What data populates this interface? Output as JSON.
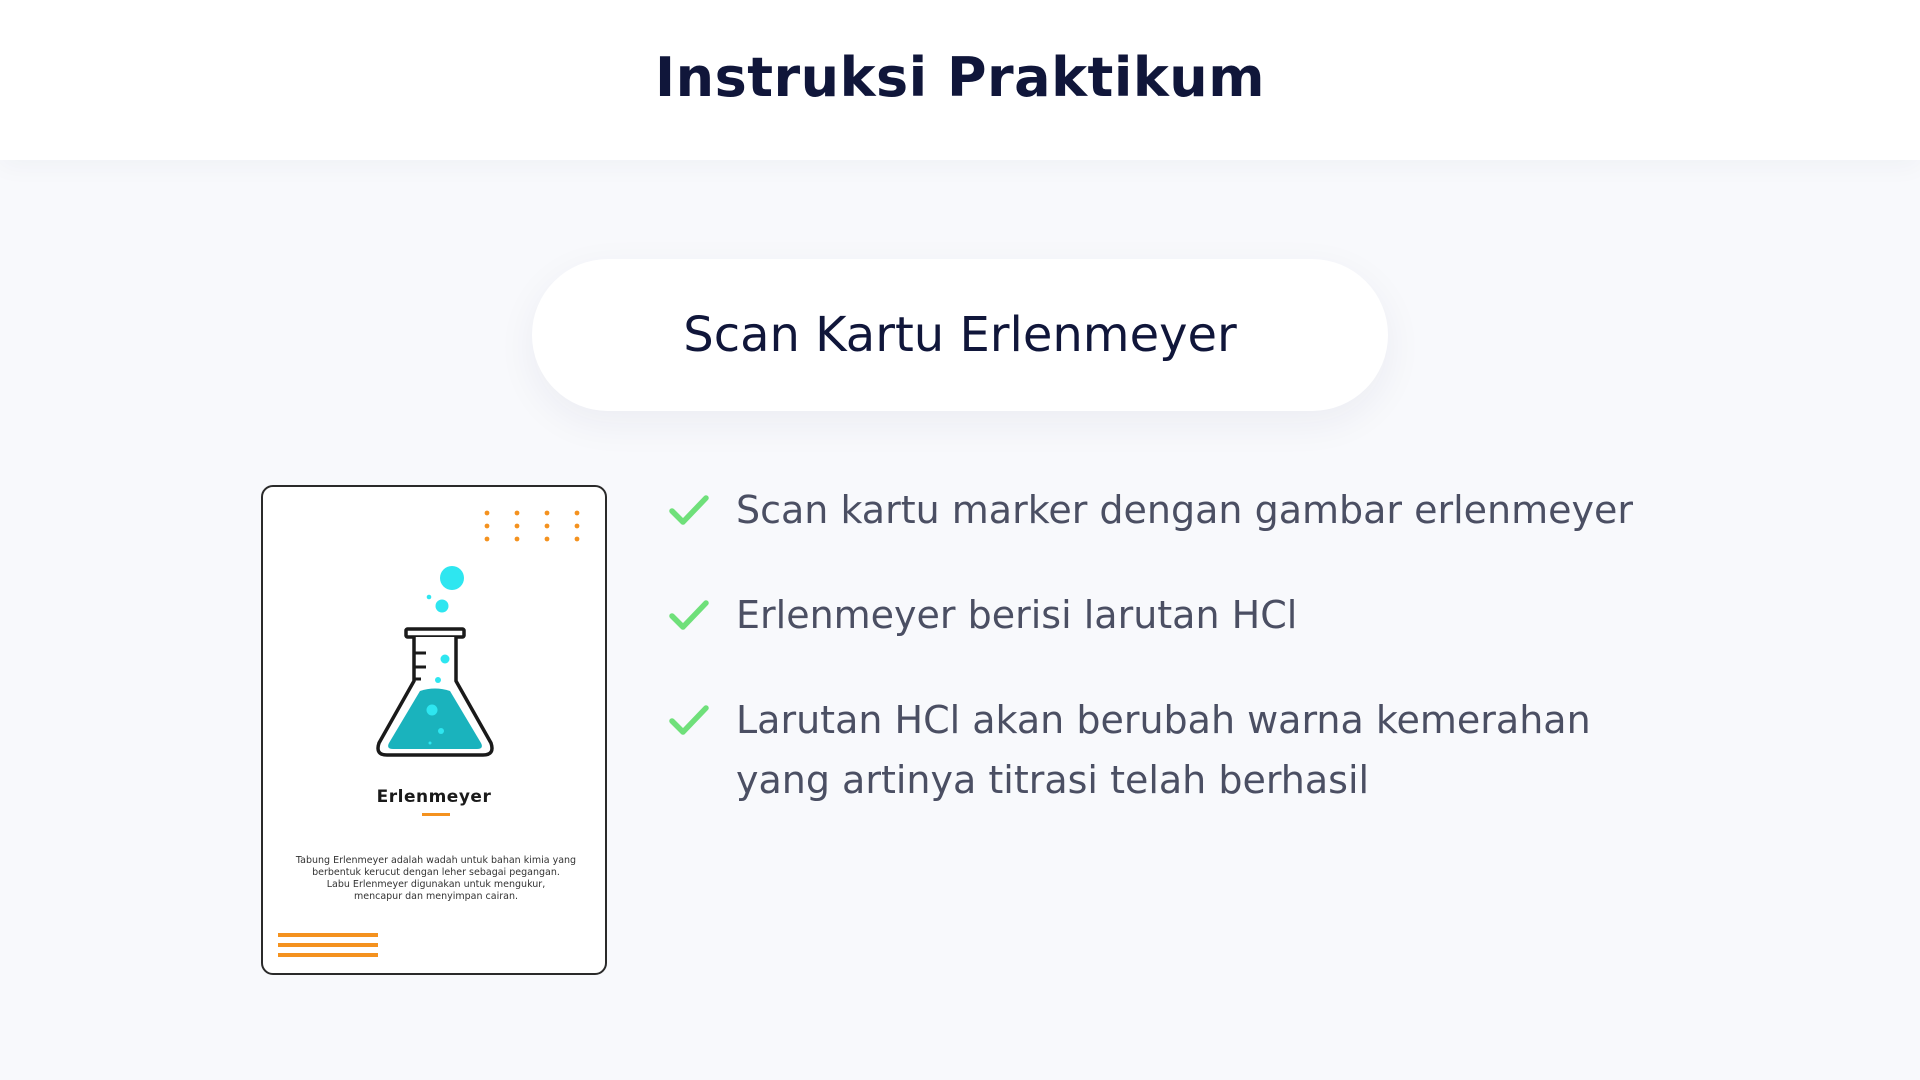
{
  "header": {
    "title": "Instruksi Praktikum"
  },
  "step": {
    "title": "Scan Kartu Erlenmeyer"
  },
  "card": {
    "title": "Erlenmeyer",
    "description_lines": [
      "Tabung Erlenmeyer adalah wadah untuk bahan kimia yang",
      "berbentuk kerucut dengan leher sebagai pegangan.",
      "Labu Erlenmeyer digunakan untuk mengukur,",
      "mencapur dan menyimpan cairan."
    ],
    "icon": "erlenmeyer-flask-icon"
  },
  "instructions": [
    {
      "text": "Scan kartu marker dengan gambar erlenmeyer",
      "icon": "check-icon"
    },
    {
      "text": "Erlenmeyer berisi larutan HCl",
      "icon": "check-icon"
    },
    {
      "text": "Larutan HCl akan berubah warna kemerahan yang artinya titrasi telah berhasil",
      "icon": "check-icon"
    }
  ],
  "colors": {
    "accent_orange": "#f4921f",
    "liquid_teal": "#1ab3bd",
    "bubble_cyan": "#2ee6f0",
    "check_green": "#6fe07a",
    "title_navy": "#10163a",
    "body_text": "#4b4f63"
  }
}
